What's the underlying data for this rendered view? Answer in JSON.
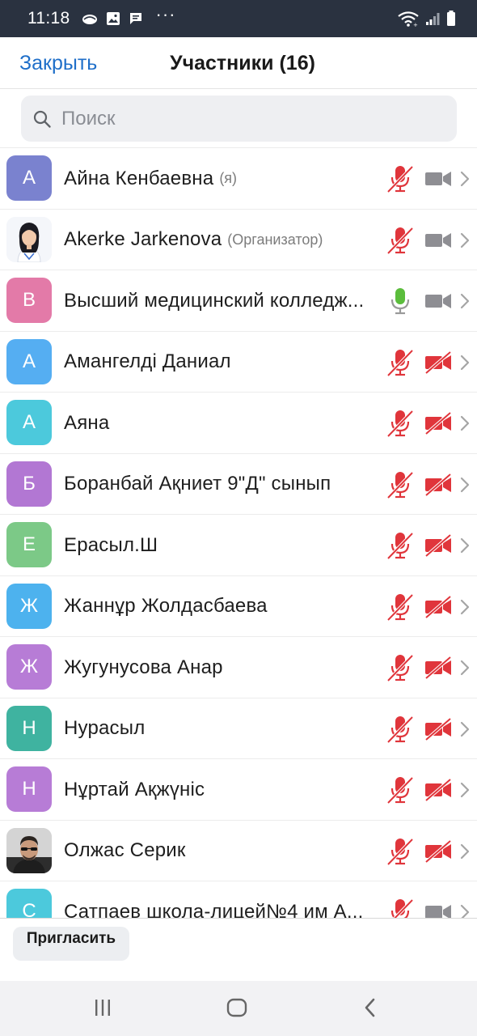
{
  "status_bar": {
    "time": "11:18",
    "icons": [
      "cloud-icon",
      "image-icon",
      "chat-icon",
      "more-dots-icon",
      "wifi-icon",
      "signal-icon",
      "battery-icon"
    ],
    "more": "···"
  },
  "header": {
    "close_label": "Закрыть",
    "title": "Участники (16)"
  },
  "search": {
    "placeholder": "Поиск",
    "value": ""
  },
  "colors": {
    "accent": "#1f6fc9",
    "muted_red": "#e0353b",
    "unmuted_green": "#5bbd3c",
    "video_on_gray": "#8e8e93"
  },
  "participants": [
    {
      "initial": "А",
      "name": "Айна Кенбаевна",
      "tag": "(я)",
      "avatar_color": "#7a82cf",
      "mic": "muted",
      "video": "on"
    },
    {
      "initial": "",
      "name": "Akerke Jarkenova",
      "tag": "(Организатор)",
      "avatar_color": "#f4f6fa",
      "avatar_photo": "woman-photo",
      "mic": "muted",
      "video": "on"
    },
    {
      "initial": "В",
      "name": "Высший медицинский колледж...",
      "tag": "",
      "avatar_color": "#e37aa8",
      "mic": "unmuted",
      "video": "on"
    },
    {
      "initial": "А",
      "name": "Амангелді Даниал",
      "tag": "",
      "avatar_color": "#55aef2",
      "mic": "muted",
      "video": "off"
    },
    {
      "initial": "А",
      "name": "Аяна",
      "tag": "",
      "avatar_color": "#4cc9dc",
      "mic": "muted",
      "video": "off"
    },
    {
      "initial": "Б",
      "name": "Боранбай Ақниет 9\"Д\" сынып",
      "tag": "",
      "avatar_color": "#b277d3",
      "mic": "muted",
      "video": "off"
    },
    {
      "initial": "Е",
      "name": "Ерасыл.Ш",
      "tag": "",
      "avatar_color": "#7cc987",
      "mic": "muted",
      "video": "off"
    },
    {
      "initial": "Ж",
      "name": "Жаннұр  Жолдасбаева",
      "tag": "",
      "avatar_color": "#4db2ee",
      "mic": "muted",
      "video": "off"
    },
    {
      "initial": "Ж",
      "name": "Жугунусова Анар",
      "tag": "",
      "avatar_color": "#b77cd6",
      "mic": "muted",
      "video": "off"
    },
    {
      "initial": "Н",
      "name": "Нурасыл",
      "tag": "",
      "avatar_color": "#3fb3a0",
      "mic": "muted",
      "video": "off"
    },
    {
      "initial": "Н",
      "name": "Нұртай Ақжүніс",
      "tag": "",
      "avatar_color": "#b77cd6",
      "mic": "muted",
      "video": "off"
    },
    {
      "initial": "",
      "name": "Олжас Серик",
      "tag": "",
      "avatar_color": "#d9d9d9",
      "avatar_photo": "man-photo",
      "mic": "muted",
      "video": "off"
    },
    {
      "initial": "С",
      "name": "Сатпаев школа-лицей№4 им А...",
      "tag": "",
      "avatar_color": "#4cc9dc",
      "mic": "muted",
      "video": "on"
    }
  ],
  "bottom": {
    "invite_label": "Пригласить"
  },
  "nav": {
    "buttons": [
      "recent-apps-icon",
      "home-icon",
      "back-icon"
    ]
  }
}
